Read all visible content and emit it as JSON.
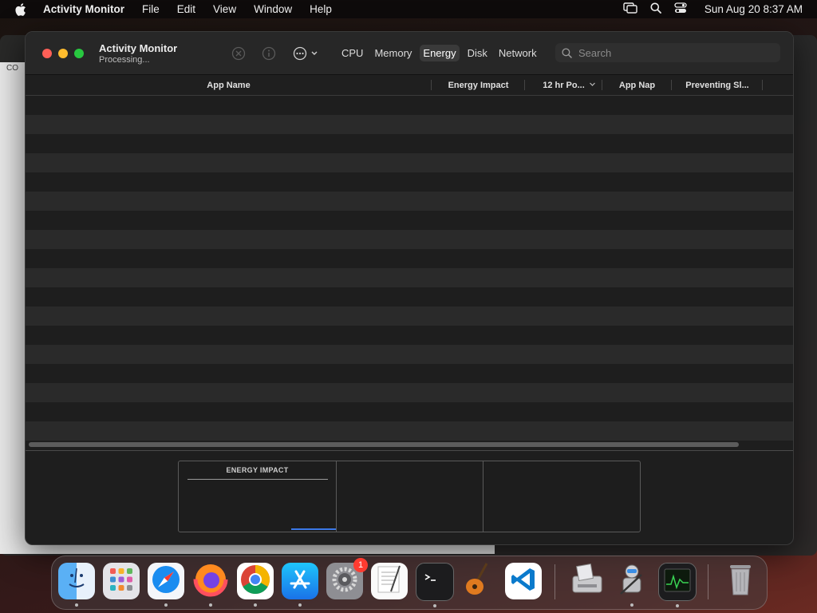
{
  "menubar": {
    "app_name": "Activity Monitor",
    "items": [
      "File",
      "Edit",
      "View",
      "Window",
      "Help"
    ],
    "clock": "Sun Aug 20  8:37 AM"
  },
  "background_window": {
    "label": "CO"
  },
  "window": {
    "title": "Activity Monitor",
    "subtitle": "Processing...",
    "tabs": [
      {
        "label": "CPU",
        "active": false
      },
      {
        "label": "Memory",
        "active": false
      },
      {
        "label": "Energy",
        "active": true
      },
      {
        "label": "Disk",
        "active": false
      },
      {
        "label": "Network",
        "active": false
      }
    ],
    "search": {
      "placeholder": "Search",
      "value": ""
    }
  },
  "table": {
    "columns": [
      "App Name",
      "Energy Impact",
      "12 hr Po...",
      "App Nap",
      "Preventing Sl..."
    ],
    "rows": []
  },
  "energy_panel": {
    "label": "ENERGY IMPACT"
  },
  "dock": {
    "apps": [
      {
        "name": "Finder",
        "running": true
      },
      {
        "name": "Launchpad",
        "running": false
      },
      {
        "name": "Safari",
        "running": true
      },
      {
        "name": "Firefox",
        "running": true
      },
      {
        "name": "Google Chrome",
        "running": true
      },
      {
        "name": "App Store",
        "running": true
      },
      {
        "name": "System Settings",
        "running": false,
        "badge": "1"
      },
      {
        "name": "TextEdit",
        "running": false
      },
      {
        "name": "Terminal",
        "running": true
      },
      {
        "name": "GarageBand",
        "running": false
      },
      {
        "name": "Visual Studio Code",
        "running": false
      },
      {
        "name": "Boot Camp Assistant",
        "running": false
      },
      {
        "name": "Automator",
        "running": true
      },
      {
        "name": "Activity Monitor",
        "running": true
      },
      {
        "name": "Trash",
        "running": false
      }
    ]
  },
  "colors": {
    "close": "#fe5f57",
    "minimize": "#febc2e",
    "zoom": "#28c840",
    "badge": "#ff3b30",
    "accent": "#3b78e7"
  }
}
